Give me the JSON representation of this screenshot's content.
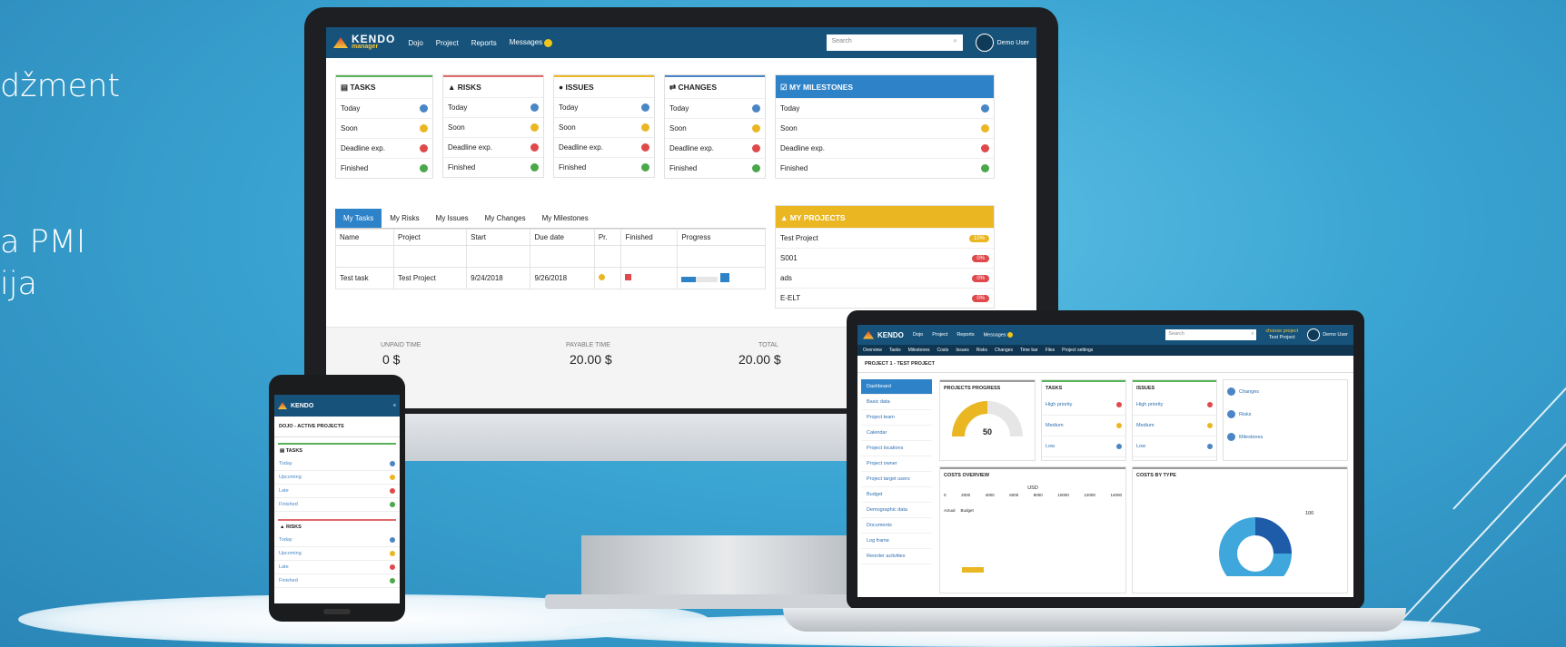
{
  "slide": {
    "line1": "džment",
    "line2": "a PMI",
    "line3": "ija"
  },
  "monitor": {
    "nav": {
      "items": [
        "Dojo",
        "Project",
        "Reports",
        "Messages"
      ],
      "search_placeholder": "Search",
      "user": "Demo User"
    },
    "cards": [
      {
        "title": "TASKS",
        "rows": [
          "Today",
          "Soon",
          "Deadline exp.",
          "Finished"
        ]
      },
      {
        "title": "RISKS",
        "rows": [
          "Today",
          "Soon",
          "Deadline exp.",
          "Finished"
        ]
      },
      {
        "title": "ISSUES",
        "rows": [
          "Today",
          "Soon",
          "Deadline exp.",
          "Finished"
        ]
      },
      {
        "title": "CHANGES",
        "rows": [
          "Today",
          "Soon",
          "Deadline exp.",
          "Finished"
        ]
      }
    ],
    "milestones": {
      "title": "MY MILESTONES",
      "rows": [
        "Today",
        "Soon",
        "Deadline exp.",
        "Finished"
      ]
    },
    "projects": {
      "title": "MY PROJECTS",
      "rows": [
        {
          "name": "Test Project",
          "pct": "10%"
        },
        {
          "name": "S001",
          "pct": "0%"
        },
        {
          "name": "ads",
          "pct": "0%"
        },
        {
          "name": "E-ELT",
          "pct": "0%"
        }
      ]
    },
    "tabs": [
      "My Tasks",
      "My Risks",
      "My Issues",
      "My Changes",
      "My Milestones"
    ],
    "table": {
      "headers": [
        "Name",
        "Project",
        "Start",
        "Due date",
        "Pr.",
        "Finished",
        "Progress"
      ],
      "row": {
        "name": "Test task",
        "project": "Test Project",
        "start": "9/24/2018",
        "due": "9/26/2018"
      }
    },
    "footer": {
      "unpaid_label": "UNPAID TIME",
      "unpaid_value": "0 $",
      "payable_label": "PAYABLE TIME",
      "payable_value": "20.00 $",
      "total_label": "TOTAL",
      "total_value": "20.00 $"
    }
  },
  "phone": {
    "title": "DOJO - ACTIVE PROJECTS",
    "tasks_title": "TASKS",
    "tasks": [
      "Today",
      "Upcoming",
      "Late",
      "Finished"
    ],
    "risks_title": "RISKS",
    "risks": [
      "Today",
      "Upcoming",
      "Late",
      "Finished"
    ]
  },
  "laptop": {
    "nav": {
      "items": [
        "Dojo",
        "Project",
        "Reports",
        "Messages"
      ],
      "search_placeholder": "Search",
      "project_label": "choose project",
      "project_name": "Test Project",
      "user": "Demo User"
    },
    "subnav": [
      "Overview",
      "Tasks",
      "Milestones",
      "Costs",
      "Issues",
      "Risks",
      "Changes",
      "Time bar",
      "Files",
      "Project settings"
    ],
    "page_title": "PROJECT 1 - TEST PROJECT",
    "side": [
      "Dashboard",
      "Basic data",
      "Project team",
      "Calendar",
      "Project locations",
      "Project owner",
      "Project target users",
      "Budget",
      "Demographic data",
      "Documents",
      "Log frame",
      "Reorder activities"
    ],
    "progress_title": "PROJECTS PROGRESS",
    "gauge_value": 50,
    "gauge_fraction": 0.5,
    "tasks_title": "TASKS",
    "issues_title": "ISSUES",
    "priorities": [
      "High priority",
      "Medium",
      "Low"
    ],
    "right_items": [
      "Changes",
      "Risks",
      "Milestones"
    ],
    "costs_overview": "COSTS OVERVIEW",
    "costs_currency": "USD",
    "costs_ticks": [
      "0",
      "2000",
      "4000",
      "6000",
      "8000",
      "10000",
      "12000",
      "14000"
    ],
    "costs_row_labels": [
      "Actual",
      "Budget"
    ],
    "costs_by_type": "COSTS BY TYPE",
    "costs_by_type_label": "100"
  }
}
